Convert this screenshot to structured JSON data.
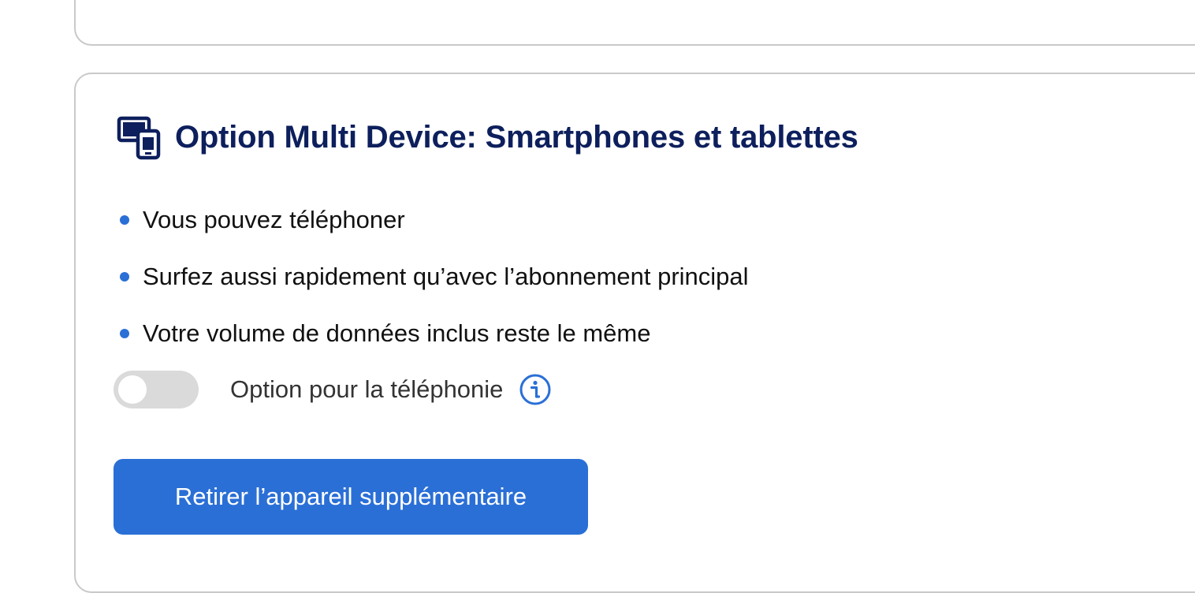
{
  "section": {
    "title": "Option Multi Device: Smartphones et tablettes",
    "icon": "multi-device-icon",
    "features": [
      "Vous pouvez téléphoner",
      "Surfez aussi rapidement qu’avec l’abonnement principal",
      "Votre volume de données inclus reste le même"
    ],
    "toggle": {
      "label": "Option pour la téléphonie",
      "state": "off",
      "info_icon": "info-icon"
    },
    "button_label": "Retirer l’appareil supplémentaire"
  },
  "colors": {
    "title": "#0d1f5c",
    "accent": "#2a6fd6",
    "toggle_off": "#dadada",
    "border": "#c9c9c9"
  }
}
